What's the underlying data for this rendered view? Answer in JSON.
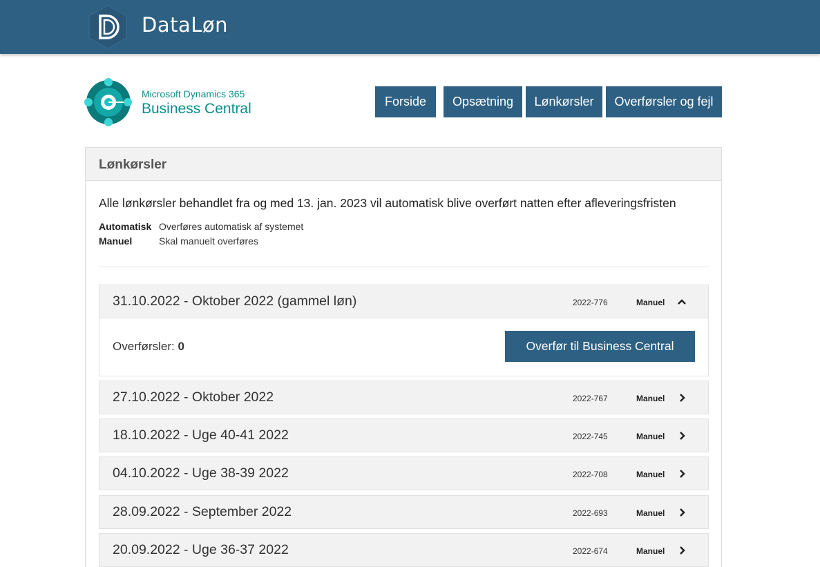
{
  "header": {
    "brand": "DataLøn",
    "logo_icon": "dataloen-logo-icon",
    "color": "#2d6083"
  },
  "product": {
    "line1": "Microsoft Dynamics 365",
    "line2": "Business Central",
    "logo_icon": "business-central-logo-icon",
    "color": "#0d8c8c"
  },
  "nav": {
    "home": "Forside",
    "setup": "Opsætning",
    "payroll_runs": "Lønkørsler",
    "transfers_errors": "Overførsler og fejl"
  },
  "panel": {
    "title": "Lønkørsler",
    "intro": "Alle lønkørsler behandlet fra og med 13. jan. 2023 vil automatisk blive overført natten efter afleveringsfristen",
    "legend": [
      {
        "key": "Automatisk",
        "value": "Overføres automatisk af systemet"
      },
      {
        "key": "Manuel",
        "value": "Skal manuelt overføres"
      }
    ]
  },
  "runs": [
    {
      "title": "31.10.2022 - Oktober 2022 (gammel løn)",
      "id": "2022-776",
      "mode": "Manuel",
      "expanded": true
    },
    {
      "title": "27.10.2022 - Oktober 2022",
      "id": "2022-767",
      "mode": "Manuel",
      "expanded": false
    },
    {
      "title": "18.10.2022 - Uge 40-41 2022",
      "id": "2022-745",
      "mode": "Manuel",
      "expanded": false
    },
    {
      "title": "04.10.2022 - Uge 38-39 2022",
      "id": "2022-708",
      "mode": "Manuel",
      "expanded": false
    },
    {
      "title": "28.09.2022 - September 2022",
      "id": "2022-693",
      "mode": "Manuel",
      "expanded": false
    },
    {
      "title": "20.09.2022 - Uge 36-37 2022",
      "id": "2022-674",
      "mode": "Manuel",
      "expanded": false
    }
  ],
  "expanded_run": {
    "transfers_label": "Overførsler: ",
    "transfers_count": "0",
    "transfer_button": "Overfør til Business Central"
  }
}
